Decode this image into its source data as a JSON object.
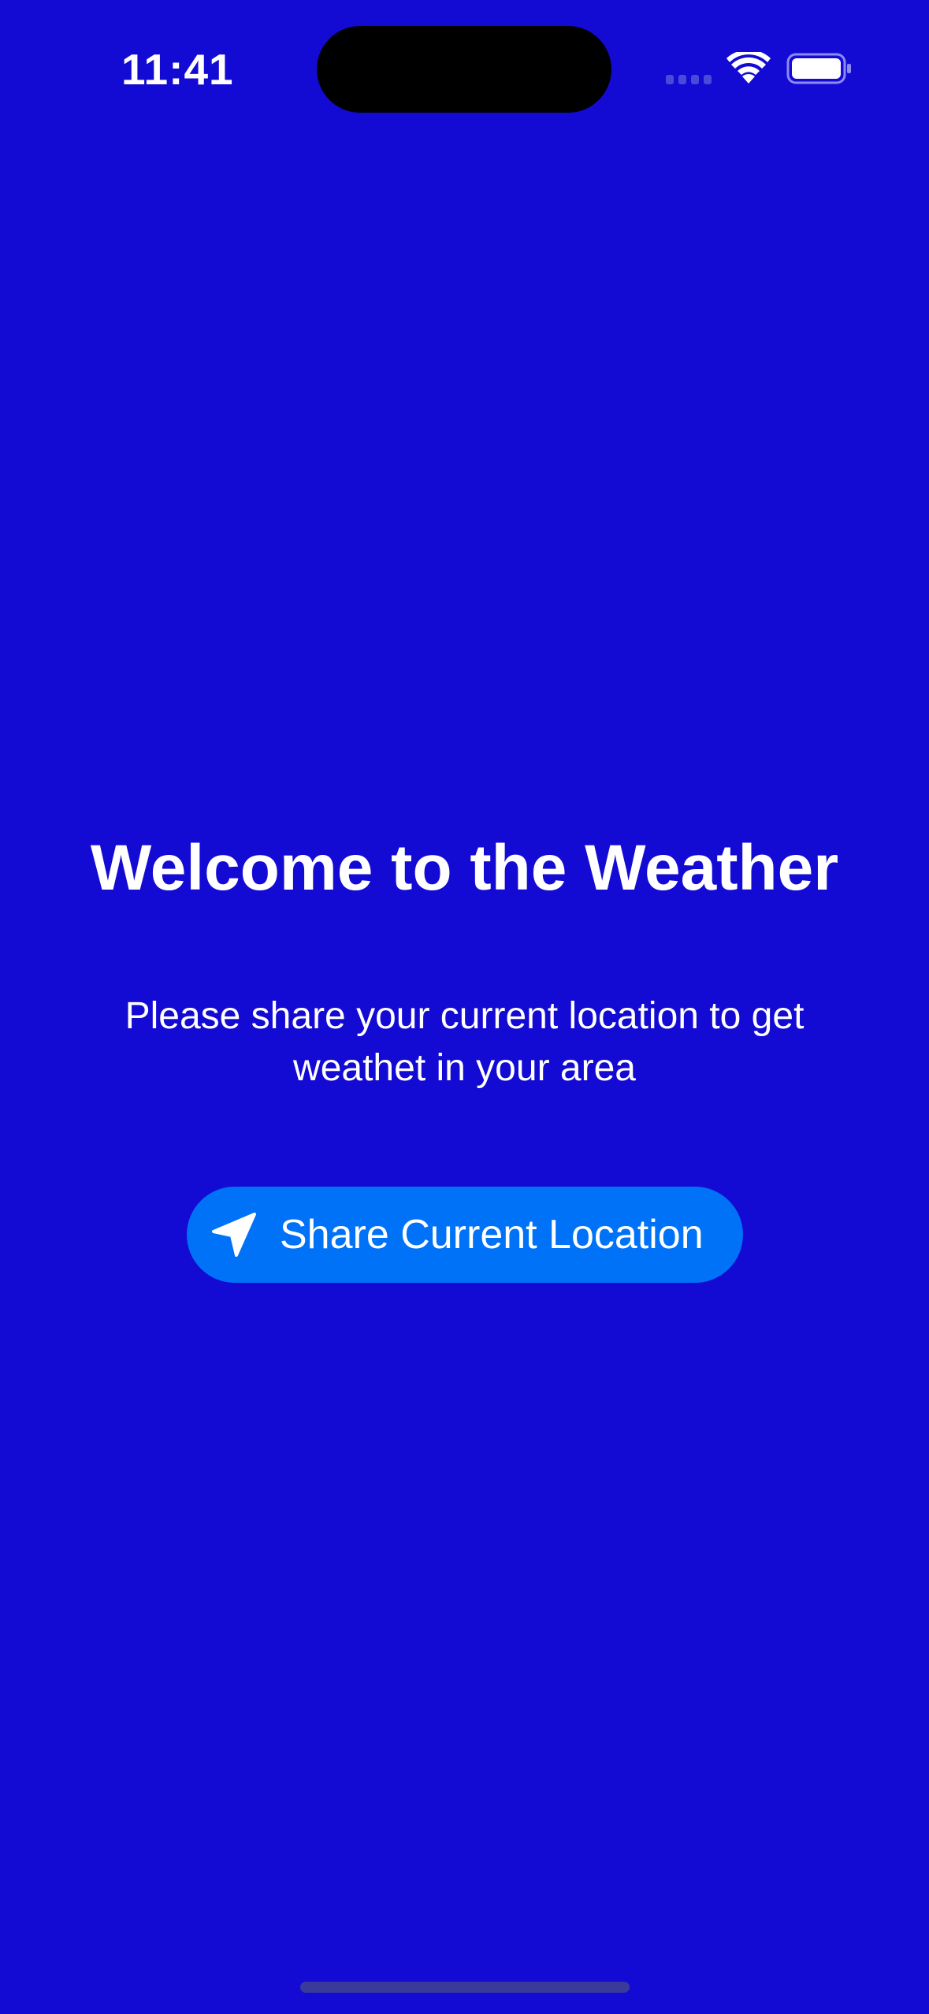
{
  "status_bar": {
    "time": "11:41",
    "icons": [
      "signal-icon",
      "wifi-icon",
      "battery-icon"
    ]
  },
  "main": {
    "title": "Welcome to the Weather",
    "subtitle": "Please share your current location to get weathet in your area",
    "share_button": {
      "label": "Share Current Location",
      "icon": "location-arrow-icon"
    }
  },
  "colors": {
    "background": "#130bd4",
    "button": "#0072f7",
    "text": "#ffffff"
  }
}
